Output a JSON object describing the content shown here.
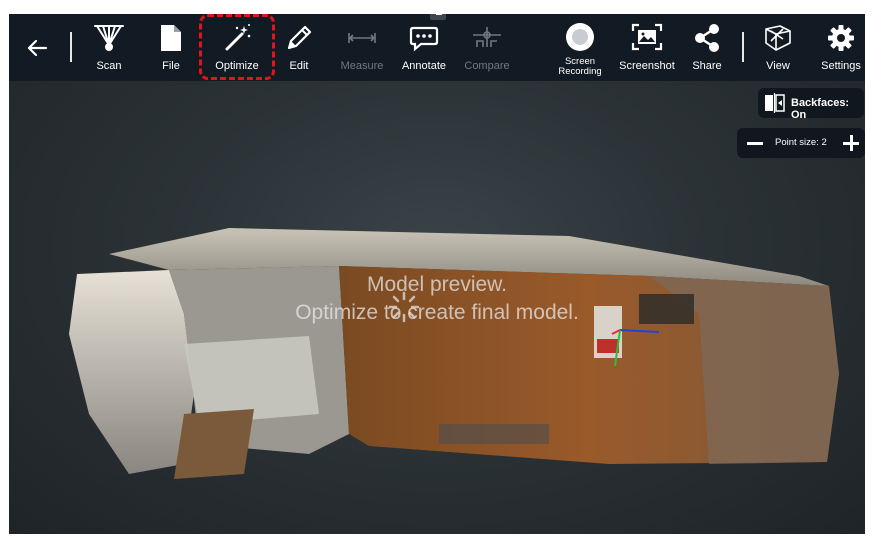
{
  "toolbar": {
    "back_label": "",
    "scan": "Scan",
    "file": "File",
    "optimize": "Optimize",
    "edit": "Edit",
    "measure": "Measure",
    "annotate": "Annotate",
    "compare": "Compare",
    "screen_recording": "Screen Recording",
    "screenshot": "Screenshot",
    "share": "Share",
    "view": "View",
    "settings": "Settings"
  },
  "controls": {
    "backfaces": "Backfaces: On",
    "point_size": "Point size: 2"
  },
  "viewport": {
    "line1": "Model preview.",
    "line2": "Optimize to create final model."
  },
  "colors": {
    "toolbar_bg": "#121a24",
    "highlight": "#e0141c",
    "disabled_text": "#707884"
  },
  "icons": [
    "back-arrow-icon",
    "scan-icon",
    "file-icon",
    "magic-wand-icon",
    "pencil-icon",
    "measure-icon",
    "annotate-icon",
    "compare-icon",
    "record-icon",
    "screenshot-icon",
    "share-icon",
    "view-cube-icon",
    "gear-icon",
    "backfaces-icon",
    "minus-icon",
    "plus-icon"
  ]
}
